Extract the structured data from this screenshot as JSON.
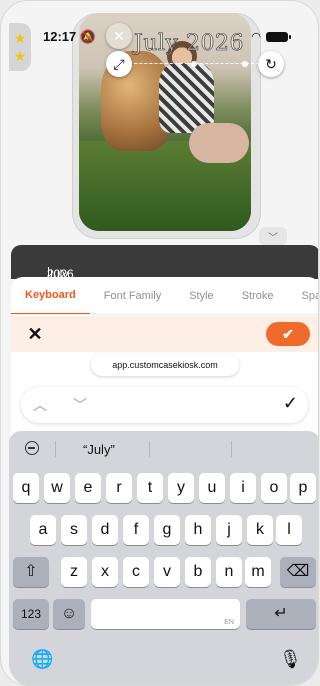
{
  "status": {
    "time": "12:17"
  },
  "canvas": {
    "overlay_text": "July 2026"
  },
  "text_input": {
    "before": "July",
    "after": "2026"
  },
  "tabs": [
    {
      "label": "Keyboard",
      "active": true
    },
    {
      "label": "Font Family",
      "active": false
    },
    {
      "label": "Style",
      "active": false
    },
    {
      "label": "Stroke",
      "active": false
    },
    {
      "label": "Spa",
      "active": false
    }
  ],
  "actions": {
    "cancel": "✕",
    "confirm": "✔"
  },
  "browser": {
    "url": "app.customcasekiosk.com"
  },
  "formnav": {
    "up": "︿",
    "down": "﹀",
    "done": "✓"
  },
  "keyboard": {
    "suggestion": "“July”",
    "row1": [
      "q",
      "w",
      "e",
      "r",
      "t",
      "y",
      "u",
      "i",
      "o",
      "p"
    ],
    "row2": [
      "a",
      "s",
      "d",
      "f",
      "g",
      "h",
      "j",
      "k",
      "l"
    ],
    "row3": [
      "z",
      "x",
      "c",
      "v",
      "b",
      "n",
      "m"
    ],
    "numbers_key": "123",
    "space_lang": "EN",
    "shift": "⇧",
    "delete": "⌫",
    "emoji": "☺",
    "return": "↵",
    "globe": "🌐",
    "mic": "🎙"
  },
  "colors": {
    "accent": "#f06a2c",
    "tab_active": "#f2571f",
    "star": "#f2c40d"
  }
}
